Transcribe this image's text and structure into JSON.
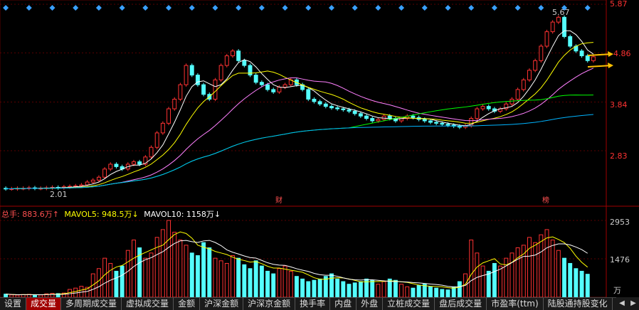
{
  "price_axis": {
    "ticks": [
      "5.87",
      "4.86",
      "3.84",
      "2.83"
    ]
  },
  "annotations": {
    "high_label": "5.67",
    "low_label": "2.01",
    "marker_cai": "财",
    "marker_bang": "榜"
  },
  "volume_header": {
    "total": "总手: 883.6万↑",
    "mavol5": "MAVOL5: 948.5万↓",
    "mavol10": "MAVOL10: 1158万↓"
  },
  "volume_axis": {
    "ticks": [
      "2953",
      "1476"
    ],
    "unit": "万"
  },
  "tabs": [
    {
      "label": "设置",
      "active": false
    },
    {
      "label": "成交量",
      "active": true
    },
    {
      "label": "多周期成交量",
      "active": false
    },
    {
      "label": "虚拟成交量",
      "active": false
    },
    {
      "label": "金额",
      "active": false
    },
    {
      "label": "沪深金额",
      "active": false
    },
    {
      "label": "沪深京金额",
      "active": false
    },
    {
      "label": "换手率",
      "active": false
    },
    {
      "label": "内盘",
      "active": false
    },
    {
      "label": "外盘",
      "active": false
    },
    {
      "label": "立桩成交量",
      "active": false
    },
    {
      "label": "盘后成交量",
      "active": false
    },
    {
      "label": "市盈率(ttm)",
      "active": false
    },
    {
      "label": "陆股通持股变化",
      "active": false
    }
  ],
  "colors": {
    "up": "#ff3232",
    "down": "#54ffff",
    "ma5": "#ffffff",
    "ma10": "#ffff00",
    "ma20": "#ff80ff",
    "ma60": "#00ff00",
    "ma120": "#00b4ff",
    "arrow": "#ffc000",
    "axis_text": "#ff3232",
    "grid": "#5a0000"
  },
  "chart_data": {
    "type": "candlestick",
    "x": [],
    "open": [
      2.05,
      2.04,
      2.04,
      2.05,
      2.05,
      2.06,
      2.05,
      2.05,
      2.06,
      2.07,
      2.06,
      2.08,
      2.09,
      2.1,
      2.12,
      2.18,
      2.22,
      2.28,
      2.45,
      2.55,
      2.5,
      2.45,
      2.55,
      2.6,
      2.55,
      2.7,
      2.9,
      3.2,
      3.4,
      3.7,
      3.9,
      4.2,
      4.6,
      4.4,
      4.2,
      4.0,
      3.9,
      4.3,
      4.6,
      4.8,
      4.9,
      4.7,
      4.6,
      4.4,
      4.25,
      4.2,
      4.1,
      4.05,
      4.15,
      4.2,
      4.3,
      4.2,
      4.1,
      3.9,
      3.85,
      3.8,
      3.75,
      3.72,
      3.7,
      3.68,
      3.65,
      3.6,
      3.55,
      3.5,
      3.45,
      3.48,
      3.55,
      3.5,
      3.45,
      3.5,
      3.55,
      3.52,
      3.48,
      3.45,
      3.42,
      3.4,
      3.38,
      3.36,
      3.34,
      3.32,
      3.35,
      3.5,
      3.7,
      3.75,
      3.7,
      3.65,
      3.7,
      3.8,
      3.9,
      4.1,
      4.3,
      4.5,
      4.7,
      5.0,
      5.3,
      5.5,
      5.6,
      5.2,
      5.0,
      4.9,
      4.8,
      4.7
    ],
    "close": [
      2.04,
      2.04,
      2.05,
      2.05,
      2.06,
      2.05,
      2.05,
      2.06,
      2.07,
      2.06,
      2.08,
      2.09,
      2.1,
      2.12,
      2.18,
      2.22,
      2.28,
      2.45,
      2.55,
      2.5,
      2.45,
      2.55,
      2.6,
      2.55,
      2.7,
      2.9,
      3.2,
      3.4,
      3.7,
      3.9,
      4.2,
      4.6,
      4.4,
      4.2,
      4.0,
      3.9,
      4.3,
      4.6,
      4.8,
      4.9,
      4.7,
      4.6,
      4.4,
      4.25,
      4.2,
      4.1,
      4.05,
      4.15,
      4.2,
      4.3,
      4.2,
      4.1,
      3.9,
      3.85,
      3.8,
      3.75,
      3.72,
      3.7,
      3.68,
      3.65,
      3.6,
      3.55,
      3.5,
      3.45,
      3.48,
      3.55,
      3.5,
      3.45,
      3.5,
      3.55,
      3.52,
      3.48,
      3.45,
      3.42,
      3.4,
      3.38,
      3.36,
      3.34,
      3.32,
      3.35,
      3.5,
      3.7,
      3.75,
      3.7,
      3.65,
      3.7,
      3.8,
      3.9,
      4.1,
      4.3,
      4.5,
      4.7,
      5.0,
      5.3,
      5.5,
      5.6,
      5.2,
      5.0,
      4.9,
      4.8,
      4.7,
      4.78
    ],
    "volume": [
      120,
      90,
      80,
      100,
      110,
      95,
      85,
      130,
      150,
      140,
      160,
      300,
      350,
      420,
      380,
      900,
      1100,
      1500,
      1300,
      1000,
      1200,
      1800,
      2200,
      1900,
      1500,
      1700,
      2300,
      2600,
      2953,
      2500,
      2200,
      2000,
      1700,
      1600,
      2100,
      1900,
      1500,
      1400,
      1300,
      1600,
      1500,
      1250,
      1100,
      1400,
      1200,
      1000,
      900,
      1100,
      1200,
      1000,
      800,
      700,
      600,
      650,
      700,
      800,
      900,
      700,
      600,
      500,
      550,
      600,
      700,
      650,
      500,
      600,
      700,
      650,
      500,
      400,
      350,
      450,
      500,
      400,
      350,
      300,
      280,
      400,
      600,
      900,
      2200,
      1700,
      1200,
      1000,
      1300,
      1200,
      1500,
      1700,
      1900,
      2000,
      2300,
      2100,
      2400,
      2600,
      2200,
      1800,
      1500,
      1300,
      1100,
      1000,
      883.6
    ],
    "ylim": [
      1.9,
      5.87
    ],
    "y_ticks": [
      2.83,
      3.84,
      4.86,
      5.87
    ],
    "high": 5.67,
    "low": 2.01,
    "volume_ylim": [
      0,
      2953
    ],
    "volume_ticks": [
      1476,
      2953
    ],
    "volume_unit": "万",
    "mavol5": 948.5,
    "mavol10": 1158,
    "grid": true
  }
}
